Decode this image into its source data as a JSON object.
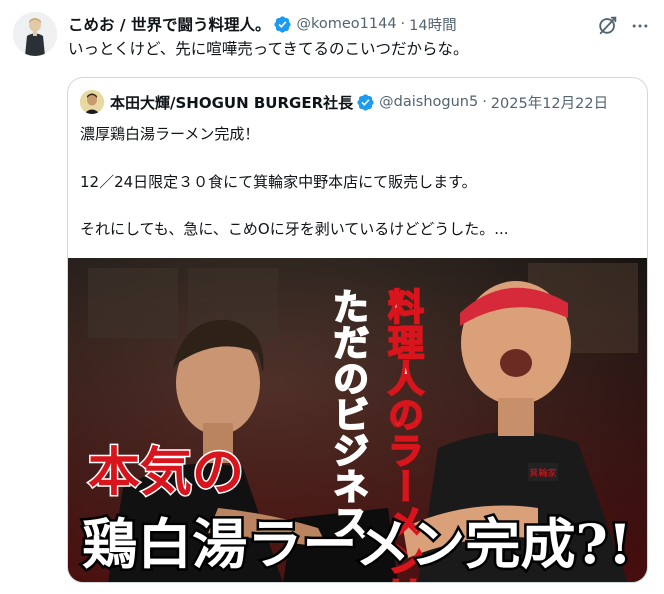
{
  "tweet": {
    "author_name": "こめお / 世界で闘う料理人。",
    "handle": "@komeo1144",
    "separator": "·",
    "time": "14時間",
    "text": "いっとくけど、先に喧嘩売ってきてるのこいつだからな。"
  },
  "quote": {
    "author_name": "本田大輝/SHOGUN BURGER社長",
    "handle": "@daishogun5",
    "separator": "·",
    "date": "2025年12月22日",
    "lines": [
      "濃厚鶏白湯ラーメン完成！",
      "12／24日限定３０食にて箕輪家中野本店にて販売します。",
      "それにしても、急に、こめOに牙を剥いているけどどうした。..."
    ]
  },
  "thumbnail": {
    "vertical_text_col1": "料理人のラーメンは",
    "vertical_text_col2": "ただのビジネス",
    "headline_top": "本気の",
    "headline_bottom": "鶏白湯ラーメン完成?!",
    "shirt_logo": "箕輪家"
  },
  "colors": {
    "verified_blue": "#1d9bf0",
    "secondary_text": "#536471",
    "border": "#cfd9de",
    "thumb_red": "#d8141c"
  }
}
